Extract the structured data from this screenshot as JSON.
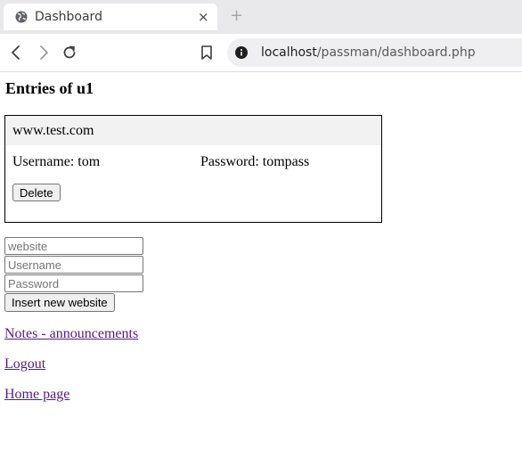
{
  "browser": {
    "tab_title": "Dashboard",
    "tab_close": "×",
    "new_tab": "+",
    "url_host": "localhost",
    "url_path": "/passman/dashboard.php",
    "icons": {
      "favicon": "globe-icon",
      "back": "back-arrow-icon",
      "forward": "forward-arrow-icon",
      "reload": "reload-icon",
      "bookmark": "bookmark-icon",
      "site_info": "info-icon"
    }
  },
  "page": {
    "heading": "Entries of u1",
    "entries": [
      {
        "website": "www.test.com",
        "username": "Username: tom",
        "password": "Password: tompass",
        "delete_label": "Delete"
      }
    ],
    "form": {
      "website_placeholder": "website",
      "username_placeholder": "Username",
      "password_placeholder": "Password",
      "submit_label": "Insert new website"
    },
    "links": {
      "notes": "Notes - announcements",
      "logout": "Logout",
      "home": "Home page"
    },
    "colors": {
      "link_visited": "#551a8b",
      "entry_header_bg": "#f2f2f2"
    }
  }
}
